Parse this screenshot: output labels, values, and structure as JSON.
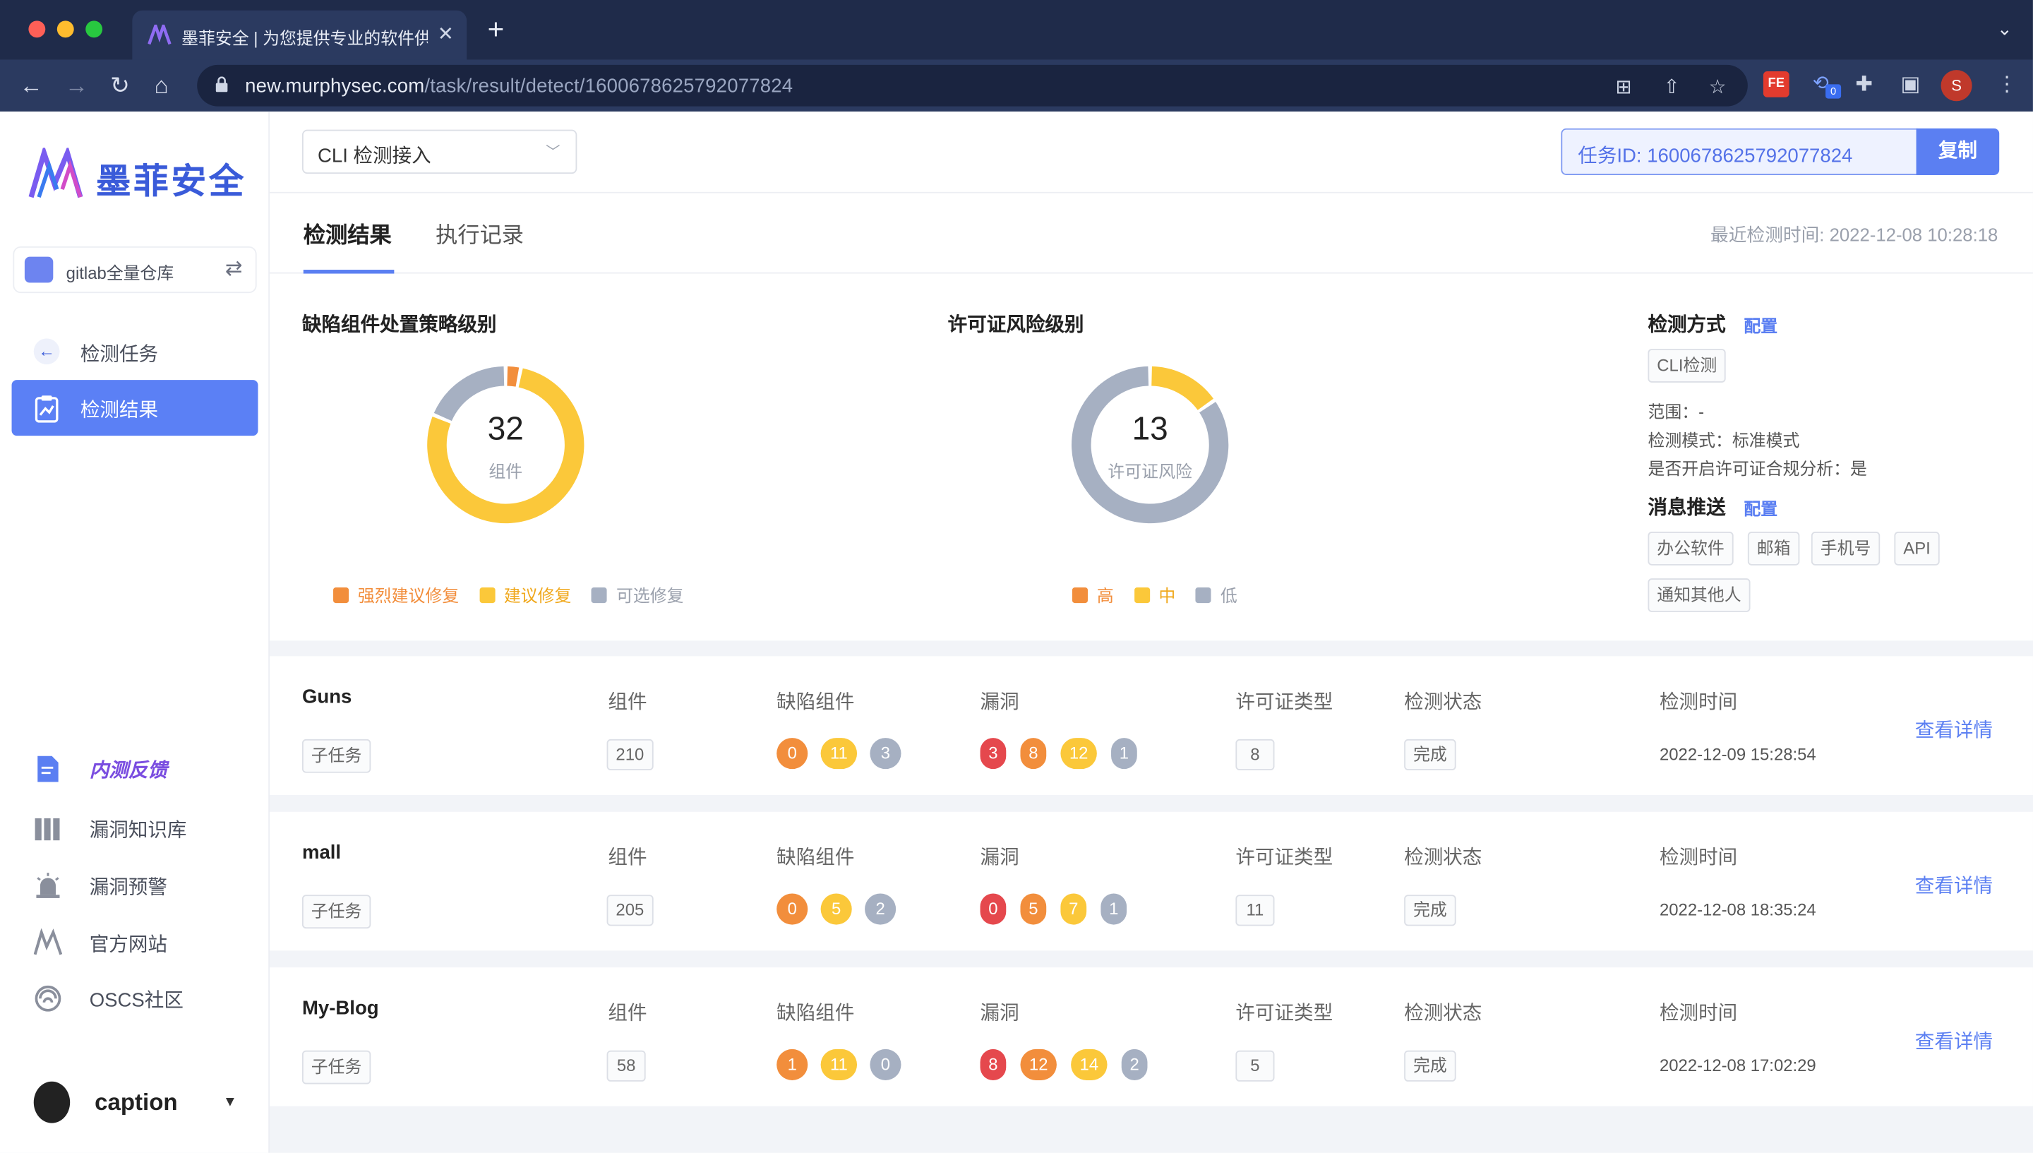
{
  "colors": {
    "accent": "#5b7ff2",
    "sidebar_active": "#5b80f5",
    "strong": "#f28e3c",
    "medium": "#fbc83a",
    "optional": "#a6b0c2",
    "high": "#e5484d",
    "neutral": "#a6b0c2"
  },
  "browser": {
    "tab_title": "墨菲安全 | 为您提供专业的软件供",
    "url_host": "new.murphysec.com",
    "url_path": "/task/result/detect/1600678625792077824",
    "ext_badge": "FE",
    "ext_count": "0",
    "profile_initial": "S"
  },
  "sidebar": {
    "brand": "墨菲安全",
    "project_name": "gitlab全量仓库",
    "back_label": "检测任务",
    "active_label": "检测结果",
    "links": {
      "feedback": "内测反馈",
      "vuln_db": "漏洞知识库",
      "vuln_alert": "漏洞预警",
      "official_site": "官方网站",
      "oscs": "OSCS社区"
    },
    "user_name": "caption"
  },
  "header": {
    "select_value": "CLI 检测接入",
    "task_id_label": "任务ID: 1600678625792077824",
    "copy_label": "复制"
  },
  "summary": {
    "tabs": [
      "检测结果",
      "执行记录"
    ],
    "last_detect": "最近检测时间: 2022-12-08 10:28:18",
    "defect_chart": {
      "title": "缺陷组件处置策略级别",
      "total": "32",
      "unit": "组件",
      "legend": [
        "强烈建议修复",
        "建议修复",
        "可选修复"
      ]
    },
    "license_chart": {
      "title": "许可证风险级别",
      "total": "13",
      "unit": "许可证风险",
      "legend": [
        "高",
        "中",
        "低"
      ]
    },
    "detect_method": {
      "title": "检测方式",
      "config": "配置",
      "tag": "CLI检测",
      "scope": "范围：-",
      "mode": "检测模式：标准模式",
      "license_compliance": "是否开启许可证合规分析：是"
    },
    "push": {
      "title": "消息推送",
      "config": "配置",
      "tags": [
        "办公软件",
        "邮箱",
        "手机号",
        "API",
        "通知其他人"
      ]
    }
  },
  "chart_data": [
    {
      "type": "pie",
      "title": "缺陷组件处置策略级别",
      "categories": [
        "强烈建议修复",
        "建议修复",
        "可选修复"
      ],
      "values": [
        1,
        25,
        6
      ]
    },
    {
      "type": "pie",
      "title": "许可证风险级别",
      "categories": [
        "高",
        "中",
        "低"
      ],
      "values": [
        0,
        2,
        11
      ]
    }
  ],
  "table": {
    "headers": {
      "components": "组件",
      "defect": "缺陷组件",
      "vulns": "漏洞",
      "license_types": "许可证类型",
      "status": "检测状态",
      "time": "检测时间"
    },
    "sub_task": "子任务",
    "detail": "查看详情",
    "rows": [
      {
        "name": "Guns",
        "components": "210",
        "defect": [
          "0",
          "11",
          "3"
        ],
        "vulns": [
          "3",
          "8",
          "12",
          "1"
        ],
        "license_types": "8",
        "status": "完成",
        "time": "2022-12-09 15:28:54"
      },
      {
        "name": "mall",
        "components": "205",
        "defect": [
          "0",
          "5",
          "2"
        ],
        "vulns": [
          "0",
          "5",
          "7",
          "1"
        ],
        "license_types": "11",
        "status": "完成",
        "time": "2022-12-08 18:35:24"
      },
      {
        "name": "My-Blog",
        "components": "58",
        "defect": [
          "1",
          "11",
          "0"
        ],
        "vulns": [
          "8",
          "12",
          "14",
          "2"
        ],
        "license_types": "5",
        "status": "完成",
        "time": "2022-12-08 17:02:29"
      }
    ]
  }
}
